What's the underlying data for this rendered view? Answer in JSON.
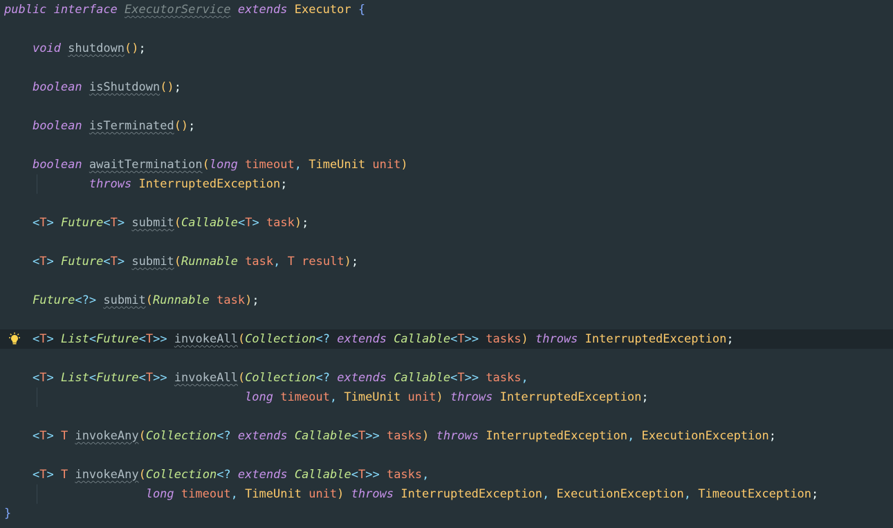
{
  "editor": {
    "lines": [
      {
        "tokens": [
          [
            "kw",
            "public"
          ],
          [
            "text",
            " "
          ],
          [
            "kw",
            "interface"
          ],
          [
            "text",
            " "
          ],
          [
            "deco-class",
            "ExecutorService"
          ],
          [
            "text",
            " "
          ],
          [
            "kw",
            "extends"
          ],
          [
            "text",
            " "
          ],
          [
            "cls",
            "Executor"
          ],
          [
            "text",
            " "
          ],
          [
            "brace",
            "{"
          ]
        ]
      },
      {
        "tokens": []
      },
      {
        "tokens": [
          [
            "text",
            "    "
          ],
          [
            "kw",
            "void"
          ],
          [
            "text",
            " "
          ],
          [
            "method",
            "shutdown"
          ],
          [
            "paren",
            "()"
          ],
          [
            "semi",
            ";"
          ]
        ]
      },
      {
        "tokens": []
      },
      {
        "tokens": [
          [
            "text",
            "    "
          ],
          [
            "kw",
            "boolean"
          ],
          [
            "text",
            " "
          ],
          [
            "method",
            "isShutdown"
          ],
          [
            "paren",
            "()"
          ],
          [
            "semi",
            ";"
          ]
        ]
      },
      {
        "tokens": []
      },
      {
        "tokens": [
          [
            "text",
            "    "
          ],
          [
            "kw",
            "boolean"
          ],
          [
            "text",
            " "
          ],
          [
            "method",
            "isTerminated"
          ],
          [
            "paren",
            "()"
          ],
          [
            "semi",
            ";"
          ]
        ]
      },
      {
        "tokens": []
      },
      {
        "tokens": [
          [
            "text",
            "    "
          ],
          [
            "kw",
            "boolean"
          ],
          [
            "text",
            " "
          ],
          [
            "method",
            "awaitTermination"
          ],
          [
            "paren",
            "("
          ],
          [
            "kw",
            "long"
          ],
          [
            "text",
            " "
          ],
          [
            "param",
            "timeout"
          ],
          [
            "punc",
            ","
          ],
          [
            "text",
            " "
          ],
          [
            "cls",
            "TimeUnit"
          ],
          [
            "text",
            " "
          ],
          [
            "param",
            "unit"
          ],
          [
            "paren",
            ")"
          ]
        ]
      },
      {
        "tokens": [
          [
            "text",
            "            "
          ],
          [
            "kw",
            "throws"
          ],
          [
            "text",
            " "
          ],
          [
            "cls",
            "InterruptedException"
          ],
          [
            "semi",
            ";"
          ]
        ]
      },
      {
        "tokens": []
      },
      {
        "tokens": [
          [
            "text",
            "    "
          ],
          [
            "pun",
            "<"
          ],
          [
            "gen",
            "T"
          ],
          [
            "pun",
            ">"
          ],
          [
            "text",
            " "
          ],
          [
            "ty",
            "Future"
          ],
          [
            "pun",
            "<"
          ],
          [
            "gen",
            "T"
          ],
          [
            "pun",
            ">"
          ],
          [
            "text",
            " "
          ],
          [
            "method",
            "submit"
          ],
          [
            "paren",
            "("
          ],
          [
            "ty",
            "Callable"
          ],
          [
            "pun",
            "<"
          ],
          [
            "gen",
            "T"
          ],
          [
            "pun",
            ">"
          ],
          [
            "text",
            " "
          ],
          [
            "param",
            "task"
          ],
          [
            "paren",
            ")"
          ],
          [
            "semi",
            ";"
          ]
        ]
      },
      {
        "tokens": []
      },
      {
        "tokens": [
          [
            "text",
            "    "
          ],
          [
            "pun",
            "<"
          ],
          [
            "gen",
            "T"
          ],
          [
            "pun",
            ">"
          ],
          [
            "text",
            " "
          ],
          [
            "ty",
            "Future"
          ],
          [
            "pun",
            "<"
          ],
          [
            "gen",
            "T"
          ],
          [
            "pun",
            ">"
          ],
          [
            "text",
            " "
          ],
          [
            "method",
            "submit"
          ],
          [
            "paren",
            "("
          ],
          [
            "ty",
            "Runnable"
          ],
          [
            "text",
            " "
          ],
          [
            "param",
            "task"
          ],
          [
            "punc",
            ","
          ],
          [
            "text",
            " "
          ],
          [
            "gen",
            "T"
          ],
          [
            "text",
            " "
          ],
          [
            "param",
            "result"
          ],
          [
            "paren",
            ")"
          ],
          [
            "semi",
            ";"
          ]
        ]
      },
      {
        "tokens": []
      },
      {
        "tokens": [
          [
            "text",
            "    "
          ],
          [
            "ty",
            "Future"
          ],
          [
            "pun",
            "<?>"
          ],
          [
            "text",
            " "
          ],
          [
            "method",
            "submit"
          ],
          [
            "paren",
            "("
          ],
          [
            "ty",
            "Runnable"
          ],
          [
            "text",
            " "
          ],
          [
            "param",
            "task"
          ],
          [
            "paren",
            ")"
          ],
          [
            "semi",
            ";"
          ]
        ]
      },
      {
        "tokens": []
      },
      {
        "tokens": [
          [
            "text",
            "    "
          ],
          [
            "pun",
            "<"
          ],
          [
            "gen",
            "T"
          ],
          [
            "pun",
            ">"
          ],
          [
            "text",
            " "
          ],
          [
            "ty",
            "List"
          ],
          [
            "pun",
            "<"
          ],
          [
            "ty",
            "Future"
          ],
          [
            "pun",
            "<"
          ],
          [
            "gen",
            "T"
          ],
          [
            "pun",
            ">>"
          ],
          [
            "text",
            " "
          ],
          [
            "method",
            "invokeAll"
          ],
          [
            "paren",
            "("
          ],
          [
            "ty",
            "Collection"
          ],
          [
            "pun",
            "<?"
          ],
          [
            "text",
            " "
          ],
          [
            "kw",
            "extends"
          ],
          [
            "text",
            " "
          ],
          [
            "ty",
            "Callable"
          ],
          [
            "pun",
            "<"
          ],
          [
            "gen",
            "T"
          ],
          [
            "pun",
            ">>"
          ],
          [
            "text",
            " "
          ],
          [
            "param",
            "tasks"
          ],
          [
            "paren",
            ")"
          ],
          [
            "text",
            " "
          ],
          [
            "kw",
            "throws"
          ],
          [
            "text",
            " "
          ],
          [
            "cls",
            "InterruptedException"
          ],
          [
            "semi",
            ";"
          ]
        ],
        "current": true
      },
      {
        "tokens": []
      },
      {
        "tokens": [
          [
            "text",
            "    "
          ],
          [
            "pun",
            "<"
          ],
          [
            "gen",
            "T"
          ],
          [
            "pun",
            ">"
          ],
          [
            "text",
            " "
          ],
          [
            "ty",
            "List"
          ],
          [
            "pun",
            "<"
          ],
          [
            "ty",
            "Future"
          ],
          [
            "pun",
            "<"
          ],
          [
            "gen",
            "T"
          ],
          [
            "pun",
            ">>"
          ],
          [
            "text",
            " "
          ],
          [
            "method",
            "invokeAll"
          ],
          [
            "paren",
            "("
          ],
          [
            "ty",
            "Collection"
          ],
          [
            "pun",
            "<?"
          ],
          [
            "text",
            " "
          ],
          [
            "kw",
            "extends"
          ],
          [
            "text",
            " "
          ],
          [
            "ty",
            "Callable"
          ],
          [
            "pun",
            "<"
          ],
          [
            "gen",
            "T"
          ],
          [
            "pun",
            ">>"
          ],
          [
            "text",
            " "
          ],
          [
            "param",
            "tasks"
          ],
          [
            "punc",
            ","
          ]
        ]
      },
      {
        "tokens": [
          [
            "text",
            "                                  "
          ],
          [
            "kw",
            "long"
          ],
          [
            "text",
            " "
          ],
          [
            "param",
            "timeout"
          ],
          [
            "punc",
            ","
          ],
          [
            "text",
            " "
          ],
          [
            "cls",
            "TimeUnit"
          ],
          [
            "text",
            " "
          ],
          [
            "param",
            "unit"
          ],
          [
            "paren",
            ")"
          ],
          [
            "text",
            " "
          ],
          [
            "kw",
            "throws"
          ],
          [
            "text",
            " "
          ],
          [
            "cls",
            "InterruptedException"
          ],
          [
            "semi",
            ";"
          ]
        ]
      },
      {
        "tokens": []
      },
      {
        "tokens": [
          [
            "text",
            "    "
          ],
          [
            "pun",
            "<"
          ],
          [
            "gen",
            "T"
          ],
          [
            "pun",
            ">"
          ],
          [
            "text",
            " "
          ],
          [
            "gen",
            "T"
          ],
          [
            "text",
            " "
          ],
          [
            "method",
            "invokeAny"
          ],
          [
            "paren",
            "("
          ],
          [
            "ty",
            "Collection"
          ],
          [
            "pun",
            "<?"
          ],
          [
            "text",
            " "
          ],
          [
            "kw",
            "extends"
          ],
          [
            "text",
            " "
          ],
          [
            "ty",
            "Callable"
          ],
          [
            "pun",
            "<"
          ],
          [
            "gen",
            "T"
          ],
          [
            "pun",
            ">>"
          ],
          [
            "text",
            " "
          ],
          [
            "param",
            "tasks"
          ],
          [
            "paren",
            ")"
          ],
          [
            "text",
            " "
          ],
          [
            "kw",
            "throws"
          ],
          [
            "text",
            " "
          ],
          [
            "cls",
            "InterruptedException"
          ],
          [
            "punc",
            ","
          ],
          [
            "text",
            " "
          ],
          [
            "cls",
            "ExecutionException"
          ],
          [
            "semi",
            ";"
          ]
        ]
      },
      {
        "tokens": []
      },
      {
        "tokens": [
          [
            "text",
            "    "
          ],
          [
            "pun",
            "<"
          ],
          [
            "gen",
            "T"
          ],
          [
            "pun",
            ">"
          ],
          [
            "text",
            " "
          ],
          [
            "gen",
            "T"
          ],
          [
            "text",
            " "
          ],
          [
            "method",
            "invokeAny"
          ],
          [
            "paren",
            "("
          ],
          [
            "ty",
            "Collection"
          ],
          [
            "pun",
            "<?"
          ],
          [
            "text",
            " "
          ],
          [
            "kw",
            "extends"
          ],
          [
            "text",
            " "
          ],
          [
            "ty",
            "Callable"
          ],
          [
            "pun",
            "<"
          ],
          [
            "gen",
            "T"
          ],
          [
            "pun",
            ">>"
          ],
          [
            "text",
            " "
          ],
          [
            "param",
            "tasks"
          ],
          [
            "punc",
            ","
          ]
        ]
      },
      {
        "tokens": [
          [
            "text",
            "                    "
          ],
          [
            "kw",
            "long"
          ],
          [
            "text",
            " "
          ],
          [
            "param",
            "timeout"
          ],
          [
            "punc",
            ","
          ],
          [
            "text",
            " "
          ],
          [
            "cls",
            "TimeUnit"
          ],
          [
            "text",
            " "
          ],
          [
            "param",
            "unit"
          ],
          [
            "paren",
            ")"
          ],
          [
            "text",
            " "
          ],
          [
            "kw",
            "throws"
          ],
          [
            "text",
            " "
          ],
          [
            "cls",
            "InterruptedException"
          ],
          [
            "punc",
            ","
          ],
          [
            "text",
            " "
          ],
          [
            "cls",
            "ExecutionException"
          ],
          [
            "punc",
            ","
          ],
          [
            "text",
            " "
          ],
          [
            "cls",
            "TimeoutException"
          ],
          [
            "semi",
            ";"
          ]
        ]
      },
      {
        "tokens": [
          [
            "brace",
            "}"
          ]
        ]
      }
    ],
    "gutter_icon": "lightbulb-icon"
  },
  "colors": {
    "background": "#263238",
    "current_line": "#1e272c",
    "keyword": "#C792EA",
    "type": "#C3E88D",
    "class": "#FFCB6B",
    "generic": "#F78C6C",
    "punctuation": "#89DDFF",
    "brace": "#82AAFF"
  }
}
